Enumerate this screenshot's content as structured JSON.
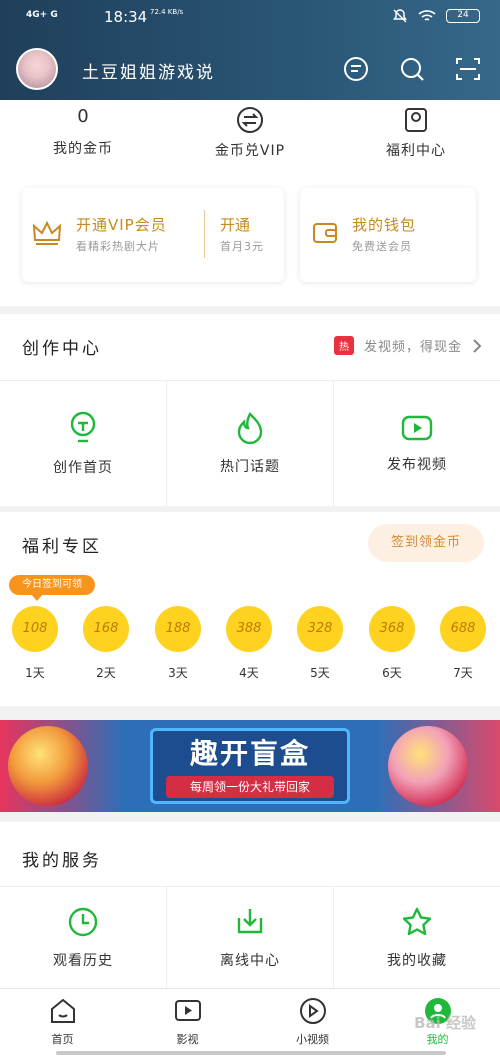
{
  "status_bar": {
    "signal": "4G+ G",
    "time": "18:34",
    "speed": "72.4 KB/s",
    "battery": "24"
  },
  "header": {
    "username": "土豆姐姐游戏说"
  },
  "quick": [
    {
      "value": "0",
      "label": "我的金币",
      "icon": "coin-value"
    },
    {
      "value": "",
      "label": "金币兑VIP",
      "icon": "exchange-icon"
    },
    {
      "value": "",
      "label": "福利中心",
      "icon": "gift-icon"
    }
  ],
  "vip": {
    "title": "开通VIP会员",
    "subtitle": "看精彩热剧大片",
    "cta": "开通",
    "price": "首月3元"
  },
  "wallet": {
    "title": "我的钱包",
    "subtitle": "免费送会员"
  },
  "creator": {
    "title": "创作中心",
    "hot_badge": "热",
    "promo": "发视频，得现金",
    "items": [
      {
        "label": "创作首页",
        "icon": "bulb-icon"
      },
      {
        "label": "热门话题",
        "icon": "flame-icon"
      },
      {
        "label": "发布视频",
        "icon": "play-upload-icon"
      }
    ]
  },
  "welfare": {
    "title": "福利专区",
    "checkin_button": "签到领金币",
    "tip": "今日签到可领",
    "coins": [
      {
        "amount": "108",
        "day": "1天"
      },
      {
        "amount": "168",
        "day": "2天"
      },
      {
        "amount": "188",
        "day": "3天"
      },
      {
        "amount": "388",
        "day": "4天"
      },
      {
        "amount": "328",
        "day": "5天"
      },
      {
        "amount": "368",
        "day": "6天"
      },
      {
        "amount": "688",
        "day": "7天"
      }
    ]
  },
  "banner": {
    "title": "趣开盲盒",
    "subtitle": "每周领一份大礼带回家"
  },
  "services": {
    "title": "我的服务",
    "items": [
      {
        "label": "观看历史",
        "icon": "clock-icon"
      },
      {
        "label": "离线中心",
        "icon": "download-icon"
      },
      {
        "label": "我的收藏",
        "icon": "star-icon"
      }
    ]
  },
  "bottom_nav": [
    {
      "label": "首页",
      "icon": "home-icon"
    },
    {
      "label": "影视",
      "icon": "film-icon"
    },
    {
      "label": "小视频",
      "icon": "play-circle-icon"
    },
    {
      "label": "我的",
      "icon": "profile-icon",
      "active": true
    }
  ],
  "watermark": "Bai 经验",
  "colors": {
    "green": "#1fb83b",
    "gold": "#c68a1e",
    "orange": "#f7941d",
    "coin": "#ffd21f"
  }
}
